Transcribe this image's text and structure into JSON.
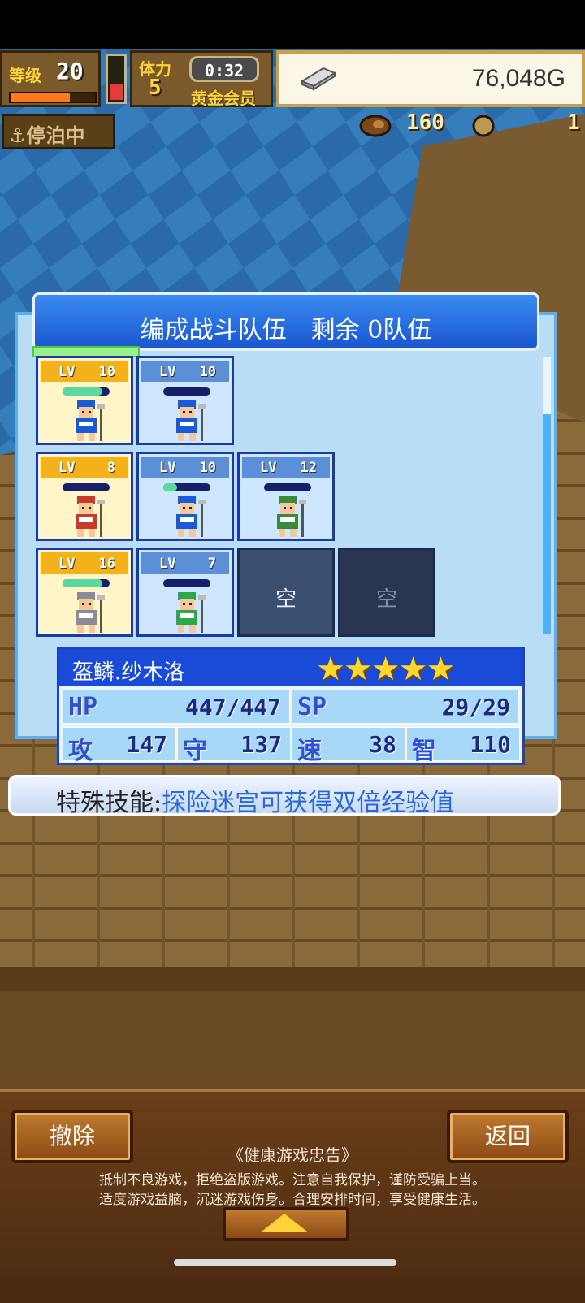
{
  "hud": {
    "level_label": "等级",
    "level_value": "20",
    "exp_fraction": 0.7,
    "stamina_label": "体力",
    "stamina_value": "5",
    "stamina_fraction": 0.35,
    "timer": "0:32",
    "membership": "黄金会员",
    "gold": "76,048G",
    "anchor_status": "停泊中",
    "resource_a": "160",
    "resource_b": "1"
  },
  "panel": {
    "title": "编成战斗队伍　剩余 0队伍"
  },
  "slots": [
    {
      "lv_label": "LV",
      "level": "10",
      "selected": true,
      "hp": 0.85
    },
    {
      "lv_label": "LV",
      "level": "10",
      "selected": false,
      "hp": 0.0
    },
    {
      "lv_label": "LV",
      "level": "8",
      "selected": true,
      "hp": 0.0
    },
    {
      "lv_label": "LV",
      "level": "10",
      "selected": false,
      "hp": 0.3
    },
    {
      "lv_label": "LV",
      "level": "12",
      "selected": false,
      "hp": 0.0
    },
    {
      "lv_label": "LV",
      "level": "16",
      "selected": true,
      "hp": 0.85
    },
    {
      "lv_label": "LV",
      "level": "7",
      "selected": false,
      "hp": 0.0
    },
    {
      "empty_label": "空"
    },
    {
      "empty_label": "空"
    }
  ],
  "character": {
    "name": "盔鳞.纱木洛",
    "stars": "★★★★★",
    "stats": {
      "hp_label": "HP",
      "hp_value": "447/447",
      "sp_label": "SP",
      "sp_value": "29/29",
      "atk_label": "攻",
      "atk_value": "147",
      "def_label": "守",
      "def_value": "137",
      "spd_label": "速",
      "spd_value": "38",
      "int_label": "智",
      "int_value": "110"
    }
  },
  "skill": {
    "label": "特殊技能:",
    "text": "探险迷宫可获得双倍经验值"
  },
  "footer": {
    "remove_button": "撤除",
    "back_button": "返回",
    "notice_title": "《健康游戏忠告》",
    "notice_line1": "抵制不良游戏，拒绝盗版游戏。注意自我保护，谨防受骗上当。",
    "notice_line2": "适度游戏益脑，沉迷游戏伤身。合理安排时间，享受健康生活。"
  },
  "colors": {
    "panel_blue": "#1a4ad8",
    "selected_slot": "#fff5c8",
    "gold_star": "#ffd62a"
  }
}
